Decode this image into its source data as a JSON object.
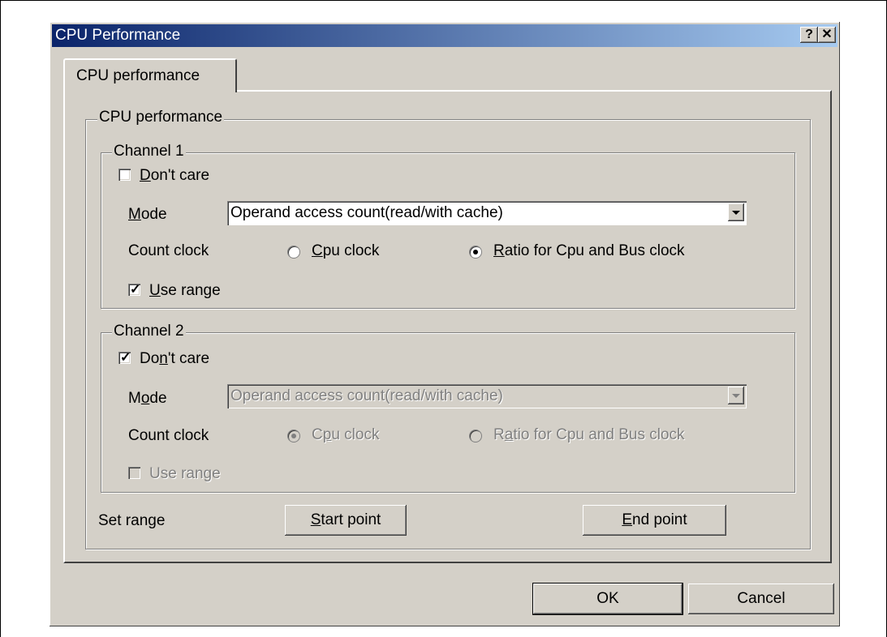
{
  "window": {
    "title": "CPU Performance",
    "help_button": "?",
    "close_button": "✕"
  },
  "tabs": [
    {
      "label": "CPU performance"
    }
  ],
  "group_main": {
    "label": "CPU performance"
  },
  "channel1": {
    "label": "Channel 1",
    "dont_care": {
      "label": "Don't care",
      "checked": false
    },
    "mode_label": "Mode",
    "mode_value": "Operand access count(read/with cache)",
    "count_clock_label": "Count clock",
    "radio_cpu": "Cpu clock",
    "radio_ratio": "Ratio for Cpu and Bus clock",
    "selected_clock": "ratio",
    "use_range": {
      "label": "Use range",
      "checked": true
    }
  },
  "channel2": {
    "label": "Channel 2",
    "dont_care": {
      "label": "Don't care",
      "checked": true
    },
    "mode_label": "Mode",
    "mode_value": "Operand access count(read/with cache)",
    "count_clock_label": "Count clock",
    "radio_cpu": "Cpu clock",
    "radio_ratio": "Ratio for Cpu and Bus clock",
    "selected_clock": "cpu",
    "use_range": {
      "label": "Use range",
      "checked": false
    }
  },
  "set_range": {
    "label": "Set range",
    "start_button": "Start point",
    "end_button": "End point"
  },
  "footer": {
    "ok": "OK",
    "cancel": "Cancel"
  },
  "colors": {
    "titlebar_start": "#0a246a",
    "titlebar_end": "#a6caf0",
    "face": "#d4d0c8"
  }
}
